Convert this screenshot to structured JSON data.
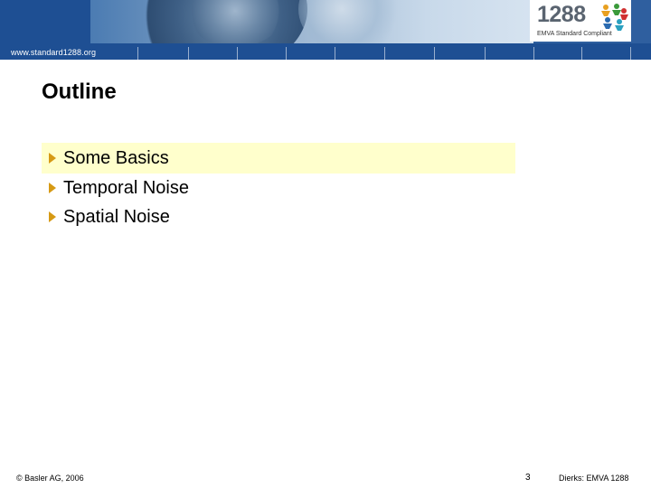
{
  "header": {
    "url": "www.standard1288.org",
    "logo": {
      "number": "1288",
      "subtitle": "EMVA Standard Compliant"
    }
  },
  "slide": {
    "title": "Outline",
    "bullets": [
      {
        "label": "Some Basics",
        "highlighted": true
      },
      {
        "label": "Temporal Noise",
        "highlighted": false
      },
      {
        "label": "Spatial Noise",
        "highlighted": false
      }
    ]
  },
  "footer": {
    "copyright": "© Basler AG, 2006",
    "page_number": "3",
    "author": "Dierks: EMVA 1288"
  },
  "colors": {
    "header_blue": "#1e4f93",
    "highlight": "#ffffcc",
    "bullet_arrow": "#d69a14"
  },
  "icons": [
    "arrow-bullet-icon",
    "logo-figures-icon"
  ]
}
